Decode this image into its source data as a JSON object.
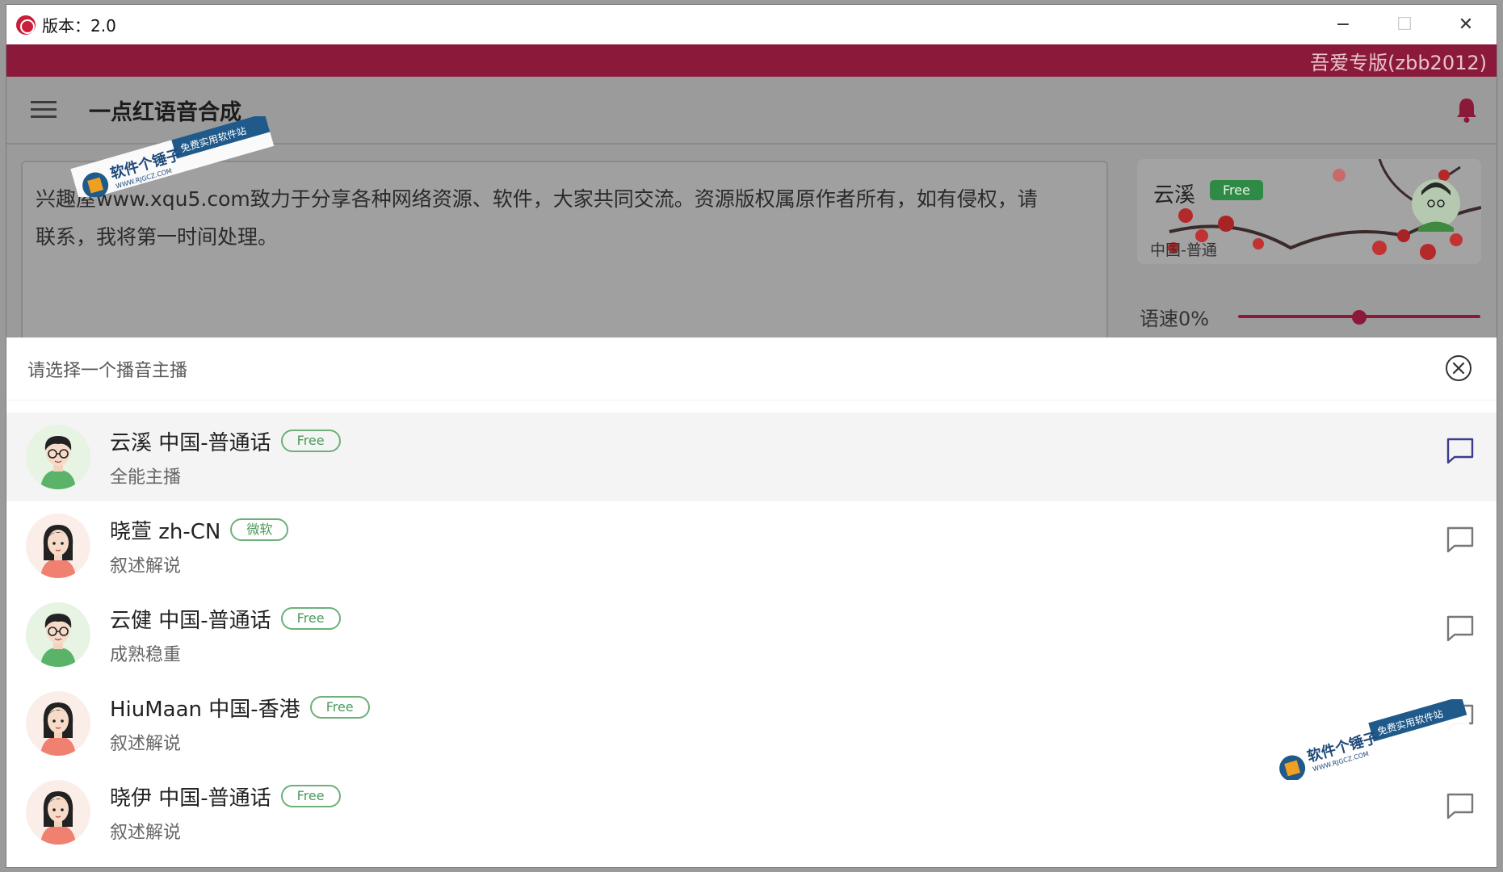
{
  "window": {
    "title": "版本：2.0",
    "controls": {
      "minimize": "−",
      "maximize": "☐",
      "close": "✕"
    }
  },
  "banner": {
    "text": "吾爱专版(zbb2012)",
    "color": "#8b1a3a"
  },
  "toolbar": {
    "app_name": "一点红语音合成",
    "menu_icon": "hamburger-icon",
    "bell_icon": "bell-icon"
  },
  "editor": {
    "text_line1": "兴趣屋www.xqu5.com致力于分享各种网络资源、软件，大家共同交流。资源版权属原作者所有，如有侵权，请",
    "text_line2": "联系，我将第一时间处理。"
  },
  "current_voice": {
    "name": "云溪",
    "badge": "Free",
    "locale": "中国-普通"
  },
  "speed": {
    "label": "语速0%",
    "value_fraction": 0.5
  },
  "voice_picker": {
    "title": "请选择一个播音主播",
    "close_icon": "close-circle-icon",
    "voices": [
      {
        "name": "云溪 中国-普通话",
        "tag": "Free",
        "desc": "全能主播",
        "gender": "male",
        "selected": true
      },
      {
        "name": "晓萱 zh-CN",
        "tag": "微软",
        "desc": "叙述解说",
        "gender": "female",
        "selected": false
      },
      {
        "name": "云健 中国-普通话",
        "tag": "Free",
        "desc": "成熟稳重",
        "gender": "male",
        "selected": false
      },
      {
        "name": "HiuMaan 中国-香港",
        "tag": "Free",
        "desc": "叙述解说",
        "gender": "female",
        "selected": false
      },
      {
        "name": "晓伊 中国-普通话",
        "tag": "Free",
        "desc": "叙述解说",
        "gender": "female",
        "selected": false
      }
    ]
  },
  "watermark": {
    "brand": "软件个锤子",
    "domain": "WWW.RJGCZ.COM",
    "slogan": "免费实用软件站"
  },
  "colors": {
    "accent": "#8b1a3a",
    "free_tag": "#4a9a5a",
    "selected_chat_icon": "#3b3b8f"
  }
}
